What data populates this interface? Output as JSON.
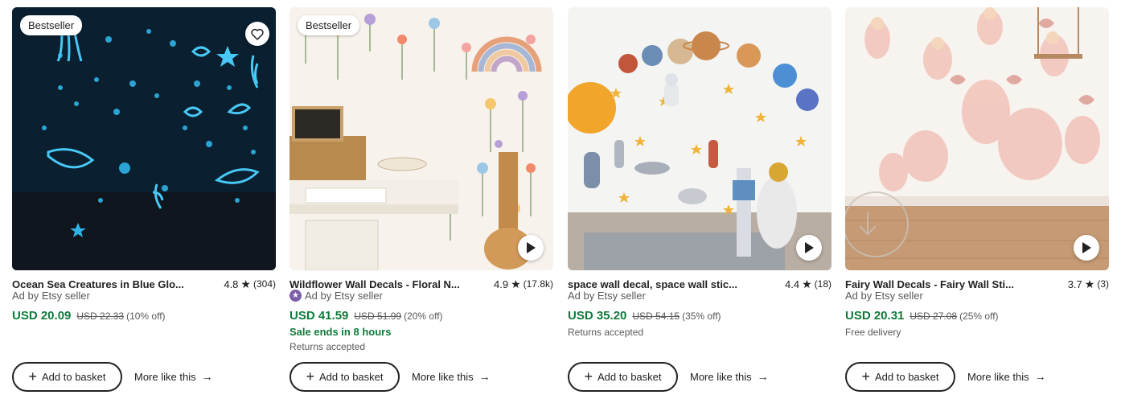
{
  "listings": [
    {
      "badge": "Bestseller",
      "title": "Ocean Sea Creatures in Blue Glo...",
      "rating": "4.8",
      "reviews": "(304)",
      "seller": "Ad by Etsy seller",
      "price": "USD 20.09",
      "original_price": "USD 22.33",
      "discount": "(10% off)",
      "add_label": "Add to basket",
      "more_label": "More like this"
    },
    {
      "badge": "Bestseller",
      "title": "Wildflower Wall Decals - Floral N...",
      "rating": "4.9",
      "reviews": "(17.8k)",
      "seller": "Ad by Etsy seller",
      "price": "USD 41.59",
      "original_price": "USD 51.99",
      "discount": "(20% off)",
      "sale_text": "Sale ends in 8 hours",
      "note": "Returns accepted",
      "add_label": "Add to basket",
      "more_label": "More like this"
    },
    {
      "title": "space wall decal, space wall stic...",
      "rating": "4.4",
      "reviews": "(18)",
      "seller": "Ad by Etsy seller",
      "price": "USD 35.20",
      "original_price": "USD 54.15",
      "discount": "(35% off)",
      "note": "Returns accepted",
      "add_label": "Add to basket",
      "more_label": "More like this"
    },
    {
      "title": "Fairy Wall Decals - Fairy Wall Sti...",
      "rating": "3.7",
      "reviews": "(3)",
      "seller": "Ad by Etsy seller",
      "price": "USD 20.31",
      "original_price": "USD 27.08",
      "discount": "(25% off)",
      "note": "Free delivery",
      "add_label": "Add to basket",
      "more_label": "More like this"
    }
  ],
  "icons": {
    "favorite": "heart-icon",
    "play": "play-icon",
    "rating": "star-icon",
    "star_seller": "star-seller-icon",
    "add": "plus-icon",
    "more": "arrow-right-icon"
  },
  "colors": {
    "price": "#0f7a3a",
    "star_seller": "#7b5ea7",
    "text": "#222222",
    "muted": "#595959"
  }
}
